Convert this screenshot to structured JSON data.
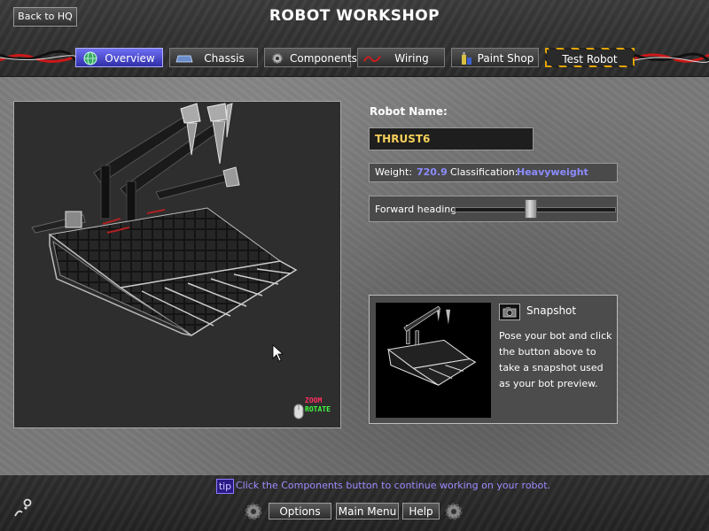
{
  "header": {
    "back_label": "Back to HQ",
    "title": "ROBOT WORKSHOP"
  },
  "tabs": [
    {
      "label": "Overview",
      "icon": "globe-icon",
      "active": true
    },
    {
      "label": "Chassis",
      "icon": "chassis-icon",
      "active": false
    },
    {
      "label": "Components",
      "icon": "gear-icon",
      "active": false
    },
    {
      "label": "Wiring",
      "icon": "wire-icon",
      "active": false
    },
    {
      "label": "Paint Shop",
      "icon": "paint-can-icon",
      "active": false
    },
    {
      "label": "Test Robot",
      "icon": null,
      "active": false
    }
  ],
  "viewport": {
    "zoom_hint": "ZOOM",
    "rotate_hint": "ROTATE"
  },
  "robot": {
    "name_label": "Robot Name:",
    "name_value": "THRUST6",
    "weight_label": "Weight:",
    "weight_value": "720.9",
    "class_label": "Classification:",
    "class_value": "Heavyweight",
    "heading_label": "Forward heading:",
    "heading_value_fraction": 0.48
  },
  "snapshot": {
    "title": "Snapshot",
    "description": "Pose your bot and click the button above to take a snapshot used as your bot preview."
  },
  "footer": {
    "tip_badge": "tip",
    "tip_text": "Click the Components button to continue working on your robot.",
    "options_label": "Options",
    "main_menu_label": "Main Menu",
    "help_label": "Help"
  },
  "colors": {
    "accent_active_tab": "#5050e0",
    "name_text": "#f5cf5a",
    "stat_value": "#8c8cff",
    "tip_text": "#9c8cff",
    "zoom_hint": "#ff3060",
    "rotate_hint": "#40ff40"
  }
}
